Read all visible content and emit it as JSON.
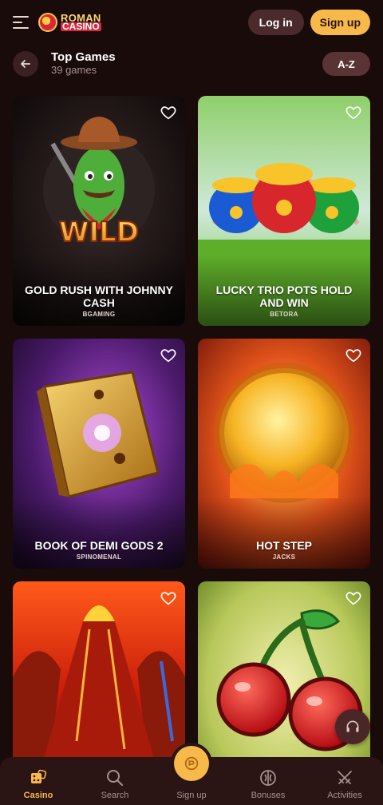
{
  "header": {
    "logo_line1": "ROMAN",
    "logo_line2": "CASINO",
    "login_label": "Log in",
    "signup_label": "Sign up"
  },
  "section": {
    "title": "Top Games",
    "count": "39 games",
    "sort_label": "A-Z"
  },
  "games": [
    {
      "name": "GOLD RUSH WITH JOHNNY CASH",
      "provider": "BGAMING",
      "theme": "gold-rush"
    },
    {
      "name": "LUCKY TRIO POTS HOLD AND WIN",
      "provider": "BETORA",
      "theme": "lucky-pots"
    },
    {
      "name": "BOOK OF DEMI GODS 2",
      "provider": "SPINOMENAL",
      "theme": "book"
    },
    {
      "name": "HOT STEP",
      "provider": "JACKS",
      "theme": "hot-step"
    },
    {
      "name": "",
      "provider": "",
      "theme": "volcano"
    },
    {
      "name": "",
      "provider": "",
      "theme": "cherries"
    }
  ],
  "bottom_nav": [
    {
      "label": "Casino",
      "icon": "dice-icon",
      "active": true
    },
    {
      "label": "Search",
      "icon": "search-icon",
      "active": false
    },
    {
      "label": "Sign up",
      "icon": "signup-icon",
      "active": false
    },
    {
      "label": "Bonuses",
      "icon": "bonus-icon",
      "active": false
    },
    {
      "label": "Activities",
      "icon": "swords-icon",
      "active": false
    }
  ],
  "colors": {
    "background": "#1a0b0b",
    "accent": "#f7b94a",
    "button_dark": "#4a2a2a"
  }
}
